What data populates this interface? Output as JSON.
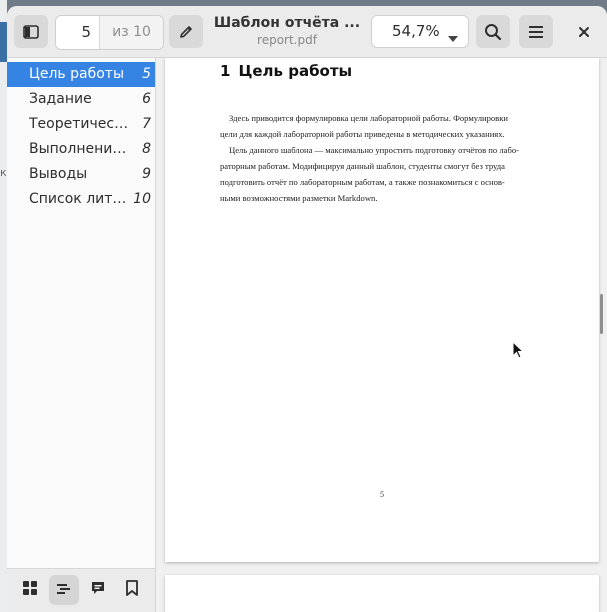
{
  "window": {
    "title": "Шаблон отчёта ...",
    "subtitle": "report.pdf"
  },
  "header": {
    "current_page": "5",
    "page_total": "из 10",
    "zoom": "54,7%"
  },
  "sidebar": {
    "items": [
      {
        "label": "Цель работы",
        "page": "5",
        "selected": true
      },
      {
        "label": "Задание",
        "page": "6",
        "selected": false
      },
      {
        "label": "Теоретичес…",
        "page": "7",
        "selected": false
      },
      {
        "label": "Выполнение…",
        "page": "8",
        "selected": false
      },
      {
        "label": "Выводы",
        "page": "9",
        "selected": false
      },
      {
        "label": "Список лите…",
        "page": "10",
        "selected": false
      }
    ]
  },
  "document": {
    "section_number": "1",
    "section_title": "Цель работы",
    "paragraph1": [
      "Здесь приводится формулировка цели лабораторной работы. Формулировки",
      "цели для каждой лабораторной работы приведены в методических указаниях."
    ],
    "paragraph2": [
      "Цель данного шаблона — максимально упростить подготовку отчётов по лабо-",
      "раторным работам. Модифицируя данный шаблон, студенты смогут без труда",
      "подготовить отчёт по лабораторным работам, а также познакомиться с основ-",
      "ными возможностями разметки Markdown."
    ],
    "page_number": "5"
  },
  "desktop": {
    "edge_text": "ка"
  },
  "colors": {
    "accent": "#3584e4",
    "headerbar": "#ebebeb"
  }
}
